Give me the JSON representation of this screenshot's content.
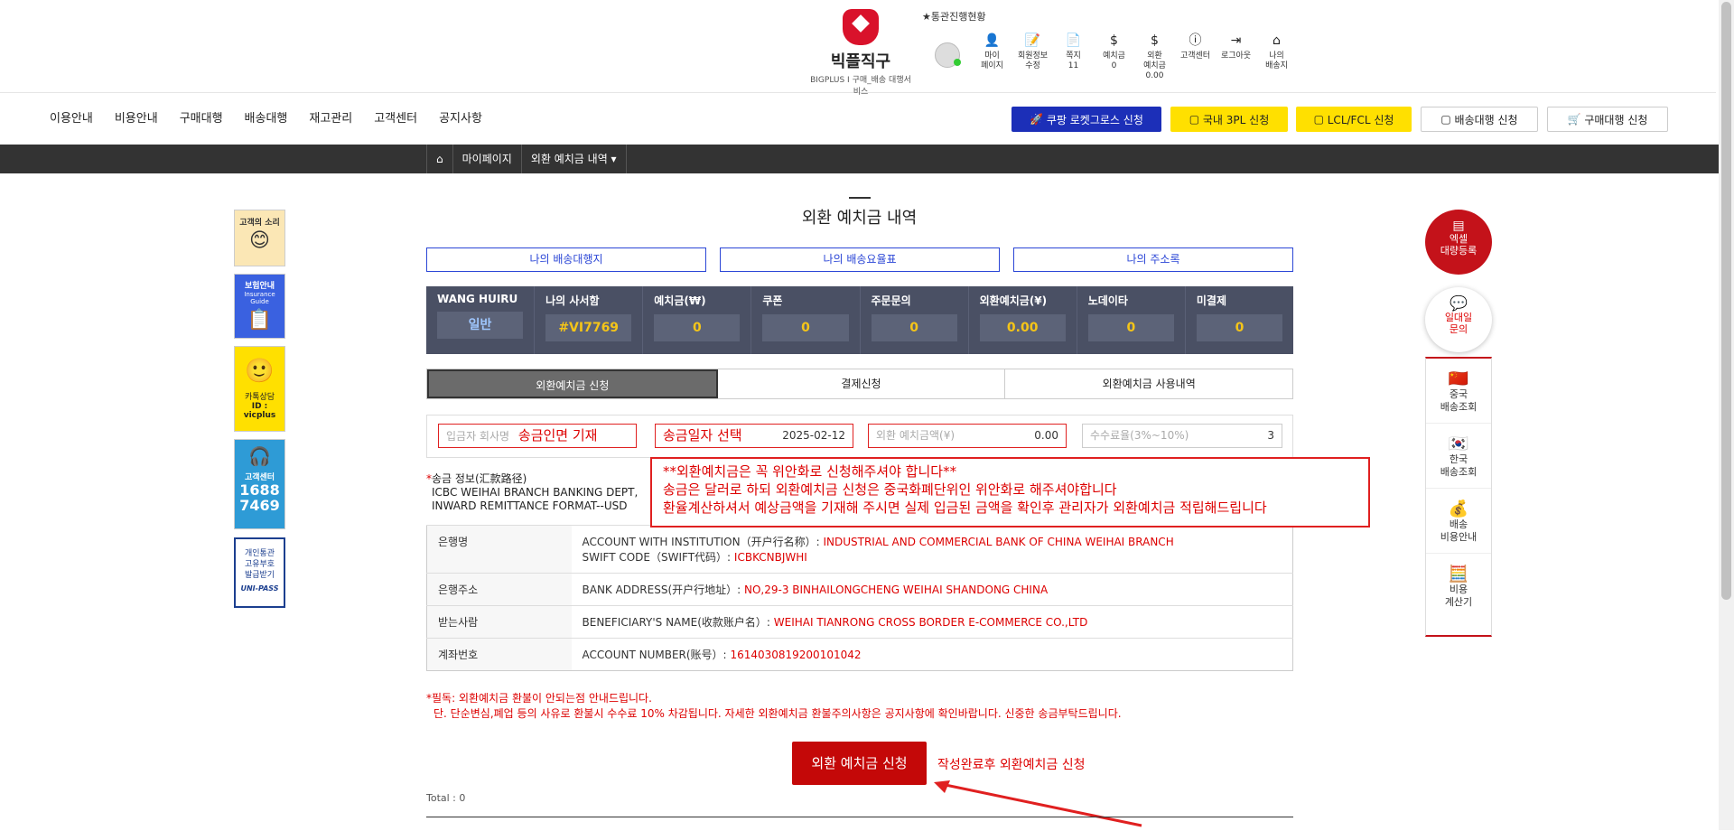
{
  "brand": {
    "name": "빅플직구",
    "subtitle": "BIGPLUS I 구매_배송 대행서비스",
    "status_link": "★통관진행현황"
  },
  "topbar": [
    {
      "label": "마이\n페이지",
      "icon": "👤"
    },
    {
      "label": "회원정보\n수정",
      "icon": "📝"
    },
    {
      "label": "쪽지\n11",
      "icon": "📄"
    },
    {
      "label": "예치금\n0",
      "icon": "$"
    },
    {
      "label": "외환\n예치금\n0.00",
      "icon": "$"
    },
    {
      "label": "고객센터",
      "icon": "ⓘ"
    },
    {
      "label": "로그아웃",
      "icon": "⇥"
    },
    {
      "label": "나의\n배송지",
      "icon": "⌂"
    }
  ],
  "menu": [
    "이용안내",
    "비용안내",
    "구매대행",
    "배송대행",
    "재고관리",
    "고객센터",
    "공지사항"
  ],
  "promo": {
    "coupang": "쿠팡 로켓그로스 신청",
    "domestic": "국내 3PL 신청",
    "lcl": "LCL/FCL 신청",
    "ship": "배송대행 신청",
    "buy": "구매대행 신청"
  },
  "breadcrumb": {
    "home": "⌂",
    "mypage": "마이페이지",
    "current": "외환 예치금 내역 ▾"
  },
  "page_title": "외환 예치금 내역",
  "top_buttons": [
    "나의 배송대행지",
    "나의 배송요율표",
    "나의 주소록"
  ],
  "info": [
    {
      "label": "WANG HUIRU",
      "value": "일반"
    },
    {
      "label": "나의 사서함",
      "value": "#VI7769"
    },
    {
      "label": "예치금(₩)",
      "value": "0"
    },
    {
      "label": "쿠폰",
      "value": "0"
    },
    {
      "label": "주문문의",
      "value": "0"
    },
    {
      "label": "외환예치금(¥)",
      "value": "0.00"
    },
    {
      "label": "노데이타",
      "value": "0"
    },
    {
      "label": "미결제",
      "value": "0"
    }
  ],
  "tabs": [
    "외환예치금 신청",
    "결제신청",
    "외환예치금 사용내역"
  ],
  "form": {
    "company_ph": "입금자 회사명",
    "company_note": "송금인면 기재",
    "date_note": "송금일자 선택",
    "date_value": "2025-02-12",
    "amount_ph": "외환 예치금액(¥)",
    "amount_value": "0.00",
    "fee_ph": "수수료율(3%~10%)",
    "fee_value": "3"
  },
  "remit": {
    "title": "송금 정보(汇款路径)",
    "line1": "ICBC WEIHAI BRANCH BANKING DEPT,",
    "line2": "INWARD REMITTANCE FORMAT--USD"
  },
  "warning": [
    "**외환예치금은 꼭 위안화로 신청해주셔야 합니다**",
    "송금은 달러로 하되 외환예치금 신청은 중국화폐단위인 위안화로 해주셔야합니다",
    "환율계산하셔서 예상금액을 기재해 주시면 실제 입금된 금액을 확인후 관리자가 외환예치금 적립해드립니다"
  ],
  "bank": [
    {
      "k": "은행명",
      "l1": "ACCOUNT WITH INSTITUTION（开户行名称）:",
      "v1": "INDUSTRIAL AND COMMERCIAL BANK OF CHINA WEIHAI BRANCH",
      "l2": "SWIFT CODE（SWIFT代码）:",
      "v2": "ICBKCNBJWHI"
    },
    {
      "k": "은행주소",
      "l1": "BANK ADDRESS(开户行地址）:",
      "v1": "NO,29-3 BINHAILONGCHENG WEIHAI SHANDONG CHINA"
    },
    {
      "k": "받는사람",
      "l1": "BENEFICIARY'S NAME(收款账户名）:",
      "v1": "WEIHAI TIANRONG CROSS BORDER E-COMMERCE CO.,LTD"
    },
    {
      "k": "계좌번호",
      "l1": "ACCOUNT NUMBER(账号）:",
      "v1": "1614030819200101042"
    }
  ],
  "notice": [
    "*필독: 외환예치금 환불이 안되는점 안내드립니다.",
    "단. 단순변심,폐업 등의 사유로 환불시 수수료 10% 차감됩니다. 자세한 외환예치금 환불주의사항은 공지사항에 확인바랍니다. 신중한 송금부탁드립니다."
  ],
  "apply": {
    "label": "외환 예치금 신청",
    "note": "작성완료후 외환예치금 신청"
  },
  "total": "Total : 0",
  "left_side": [
    {
      "title": "고객의 소리",
      "sub": ""
    },
    {
      "title": "보험안내",
      "sub": "Insurance Guide"
    },
    {
      "title": "카톡상담",
      "sub": "ID : vicplus"
    },
    {
      "title": "고객센터",
      "sub": "1688\n7469"
    },
    {
      "title": "개인통관\n고유부호\n발급받기",
      "sub": "UNI-PASS"
    }
  ],
  "right_side": [
    {
      "label": "엑셀\n대량등록"
    },
    {
      "label": "일대일\n문의"
    },
    {
      "label": "중국\n배송조회"
    },
    {
      "label": "한국\n배송조회"
    },
    {
      "label": "배송\n비용안내"
    },
    {
      "label": "비용\n계산기"
    }
  ],
  "colors": {
    "red": "#c40808",
    "blue": "#2b46d6",
    "dark": "#333333",
    "panel": "#4a5064",
    "gold": "#f5c518"
  }
}
